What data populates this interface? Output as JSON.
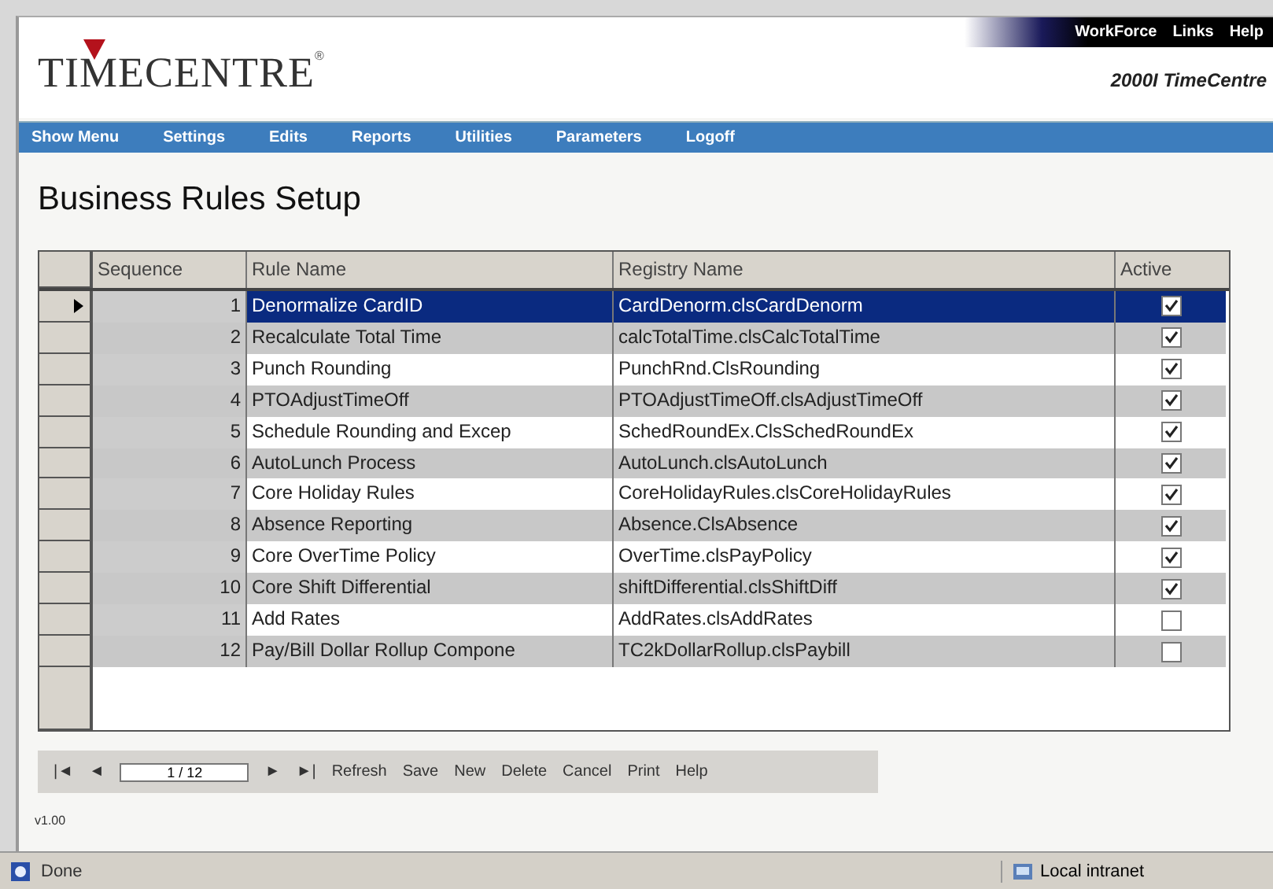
{
  "top_links": [
    "WorkForce",
    "Links",
    "Help"
  ],
  "logo": {
    "text": "TIMECENTRE",
    "mark": "®"
  },
  "product": "2000I TimeCentre",
  "menu": [
    "Show Menu",
    "Settings",
    "Edits",
    "Reports",
    "Utilities",
    "Parameters",
    "Logoff"
  ],
  "page_title": "Business Rules Setup",
  "table": {
    "columns": [
      "Sequence",
      "Rule Name",
      "Registry Name",
      "Active"
    ],
    "rows": [
      {
        "sequence": "1",
        "rule": "Denormalize CardID",
        "registry": "CardDenorm.clsCardDenorm",
        "active": true,
        "selected": true
      },
      {
        "sequence": "2",
        "rule": "Recalculate Total Time",
        "registry": "calcTotalTime.clsCalcTotalTime",
        "active": true,
        "selected": false
      },
      {
        "sequence": "3",
        "rule": "Punch Rounding",
        "registry": "PunchRnd.ClsRounding",
        "active": true,
        "selected": false
      },
      {
        "sequence": "4",
        "rule": "PTOAdjustTimeOff",
        "registry": "PTOAdjustTimeOff.clsAdjustTimeOff",
        "active": true,
        "selected": false
      },
      {
        "sequence": "5",
        "rule": "Schedule Rounding and Excep",
        "registry": "SchedRoundEx.ClsSchedRoundEx",
        "active": true,
        "selected": false
      },
      {
        "sequence": "6",
        "rule": "AutoLunch Process",
        "registry": "AutoLunch.clsAutoLunch",
        "active": true,
        "selected": false
      },
      {
        "sequence": "7",
        "rule": "Core Holiday Rules",
        "registry": "CoreHolidayRules.clsCoreHolidayRules",
        "active": true,
        "selected": false
      },
      {
        "sequence": "8",
        "rule": "Absence Reporting",
        "registry": "Absence.ClsAbsence",
        "active": true,
        "selected": false
      },
      {
        "sequence": "9",
        "rule": "Core OverTime Policy",
        "registry": "OverTime.clsPayPolicy",
        "active": true,
        "selected": false
      },
      {
        "sequence": "10",
        "rule": "Core Shift Differential",
        "registry": "shiftDifferential.clsShiftDiff",
        "active": true,
        "selected": false
      },
      {
        "sequence": "11",
        "rule": "Add Rates",
        "registry": "AddRates.clsAddRates",
        "active": false,
        "selected": false
      },
      {
        "sequence": "12",
        "rule": "Pay/Bill Dollar Rollup Compone",
        "registry": "TC2kDollarRollup.clsPaybill",
        "active": false,
        "selected": false
      }
    ]
  },
  "navigator": {
    "first": "|◄",
    "prev": "◄",
    "position": "1 / 12",
    "next": "►",
    "last": "►|",
    "buttons": [
      "Refresh",
      "Save",
      "New",
      "Delete",
      "Cancel",
      "Print",
      "Help"
    ]
  },
  "version": "v1.00",
  "status_bar": {
    "text": "Done",
    "zone": "Local intranet"
  }
}
